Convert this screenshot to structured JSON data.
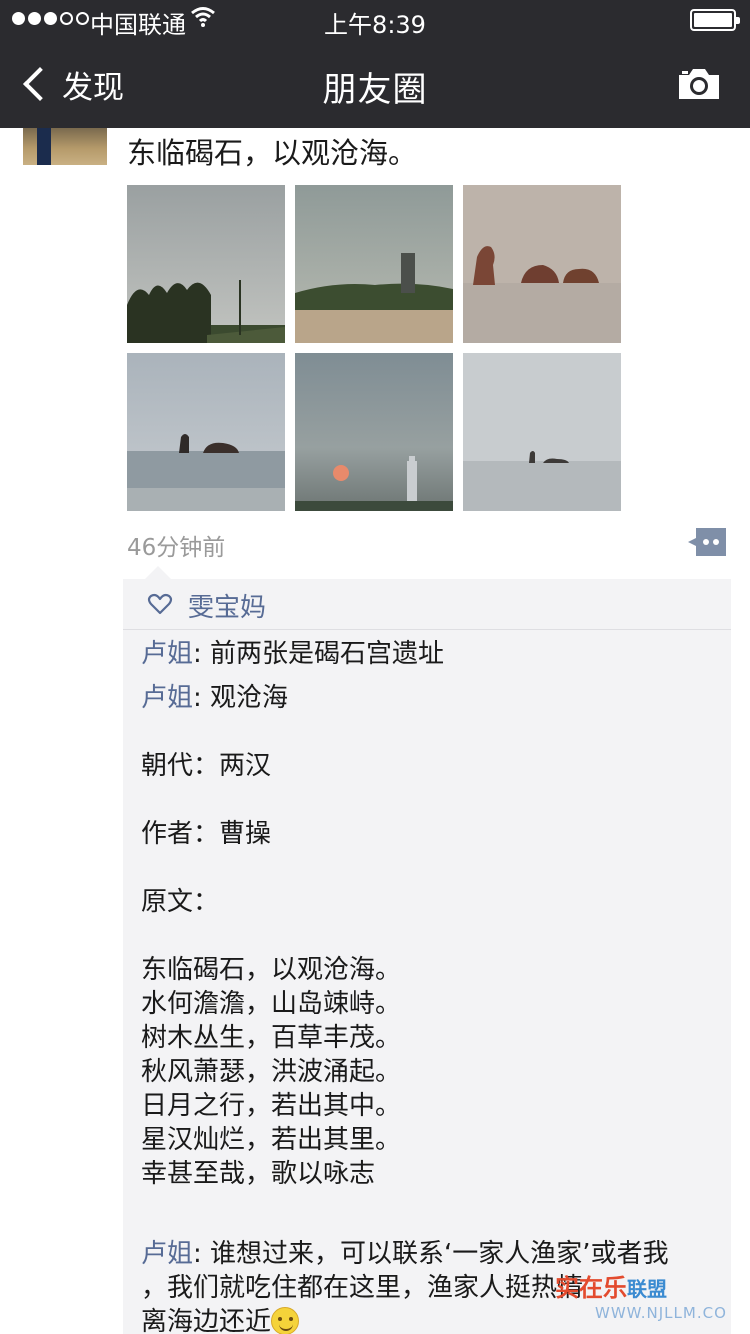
{
  "status_bar": {
    "carrier": "中国联通",
    "time": "上午8:39",
    "signal_bars_filled": 3,
    "signal_bars_total": 5,
    "battery_level": 1.0
  },
  "nav": {
    "back_label": "发现",
    "title": "朋友圈",
    "camera_icon": "camera-icon"
  },
  "post": {
    "text": "东临碣石，以观沧海。",
    "photo_count": 6,
    "time": "46分钟前",
    "comment_icon": "comment-bubble-icon"
  },
  "likes": {
    "icon": "heart-outline-icon",
    "names": "雯宝妈"
  },
  "comments": [
    {
      "author": "卢姐",
      "separator": ": ",
      "text": "前两张是碣石宫遗址"
    },
    {
      "author": "卢姐",
      "separator": ": ",
      "text": "观沧海"
    }
  ],
  "poem_lines": [
    "朝代：两汉",
    "作者：曹操",
    "原文：",
    "东临碣石，以观沧海。",
    "水何澹澹，山岛竦峙。",
    "树木丛生，百草丰茂。",
    "秋风萧瑟，洪波涌起。",
    "日月之行，若出其中。",
    "星汉灿烂，若出其里。",
    "幸甚至哉，歌以咏志"
  ],
  "last_comment": {
    "author": "卢姐",
    "separator": ": ",
    "line1": "谁想过来，可以联系‘一家人渔家’或者我",
    "line2": "，我们就吃住都在这里，渔家人挺热情",
    "line3": "离海边还近"
  },
  "watermark": {
    "text_a": "实在乐",
    "text_b": "联盟",
    "url": "WWW.NJLLM.CO"
  }
}
